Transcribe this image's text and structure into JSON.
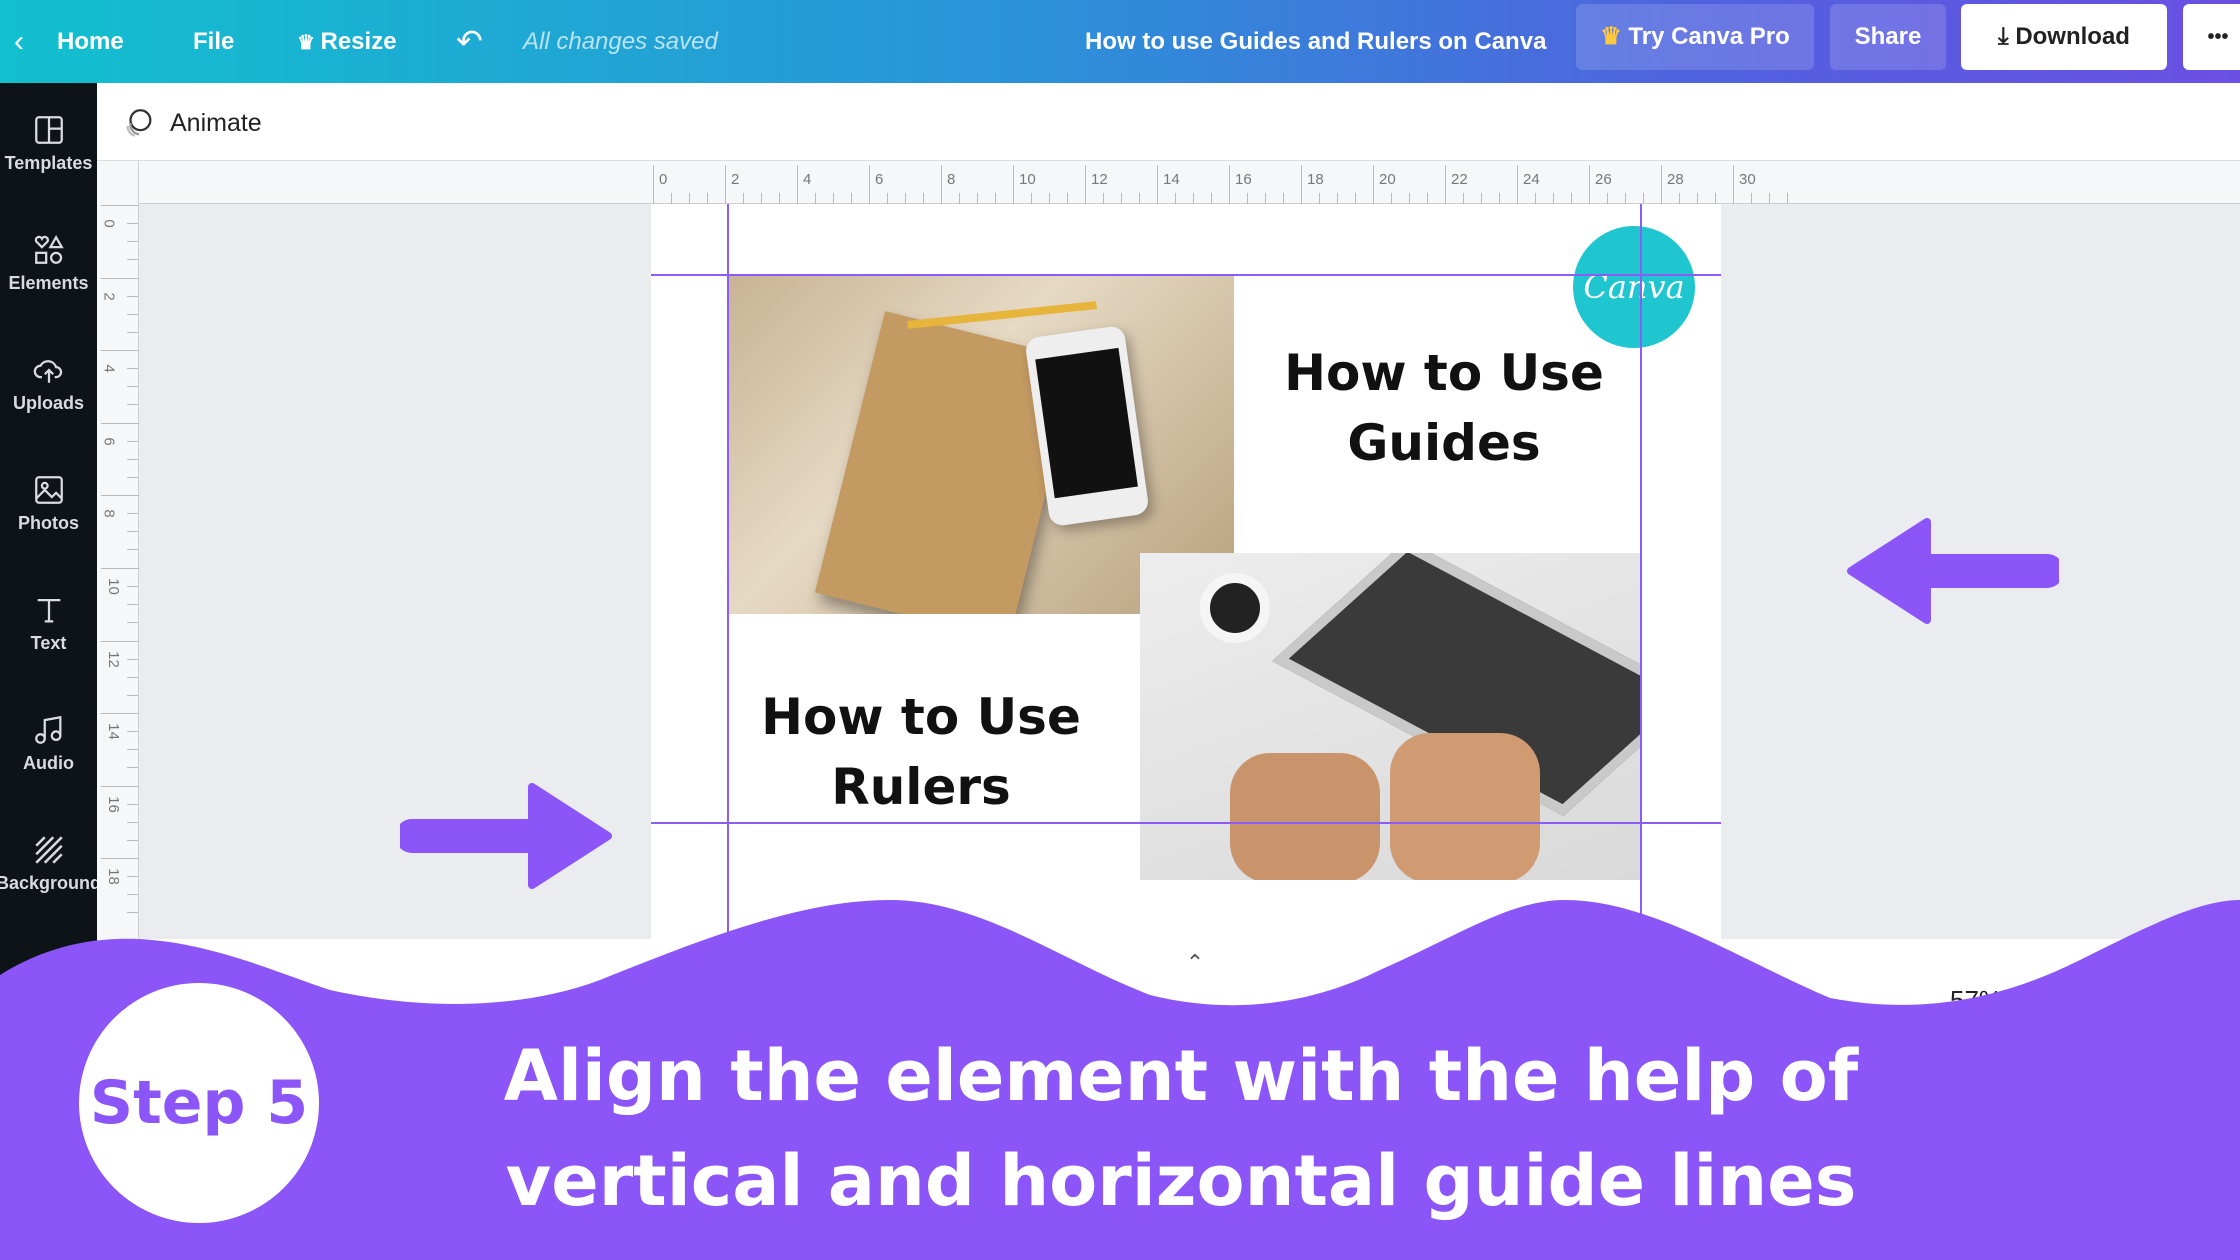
{
  "topbar": {
    "home": "Home",
    "file": "File",
    "resize": "Resize",
    "status": "All changes saved",
    "title": "How to use Guides and Rulers on Canva",
    "try_pro": "Try Canva Pro",
    "share": "Share",
    "download": "Download",
    "more": "•••"
  },
  "sidebar": {
    "items": [
      {
        "label": "Templates",
        "icon": "templates-icon"
      },
      {
        "label": "Elements",
        "icon": "elements-icon"
      },
      {
        "label": "Uploads",
        "icon": "upload-cloud-icon"
      },
      {
        "label": "Photos",
        "icon": "photo-icon"
      },
      {
        "label": "Text",
        "icon": "text-icon"
      },
      {
        "label": "Audio",
        "icon": "music-note-icon"
      },
      {
        "label": "Background",
        "icon": "background-hatch-icon"
      }
    ]
  },
  "toolbar": {
    "animate": "Animate"
  },
  "ruler": {
    "top_labels": [
      "0",
      "2",
      "4",
      "6",
      "8",
      "10",
      "12",
      "14",
      "16",
      "18",
      "20",
      "22",
      "24",
      "26",
      "28",
      "30"
    ],
    "left_labels": [
      "0",
      "2",
      "4",
      "6",
      "8",
      "10",
      "12",
      "14",
      "16",
      "18"
    ]
  },
  "design": {
    "logo": "Canva",
    "heading_guides": [
      "How to Use",
      "Guides"
    ],
    "heading_rulers": [
      "How to Use",
      "Rulers"
    ]
  },
  "footer": {
    "zoom": "57%"
  },
  "overlay": {
    "step": "Step 5",
    "caption": [
      "Align the element with the help of",
      "vertical and horizontal guide lines"
    ],
    "accent": "#8b55f7"
  }
}
